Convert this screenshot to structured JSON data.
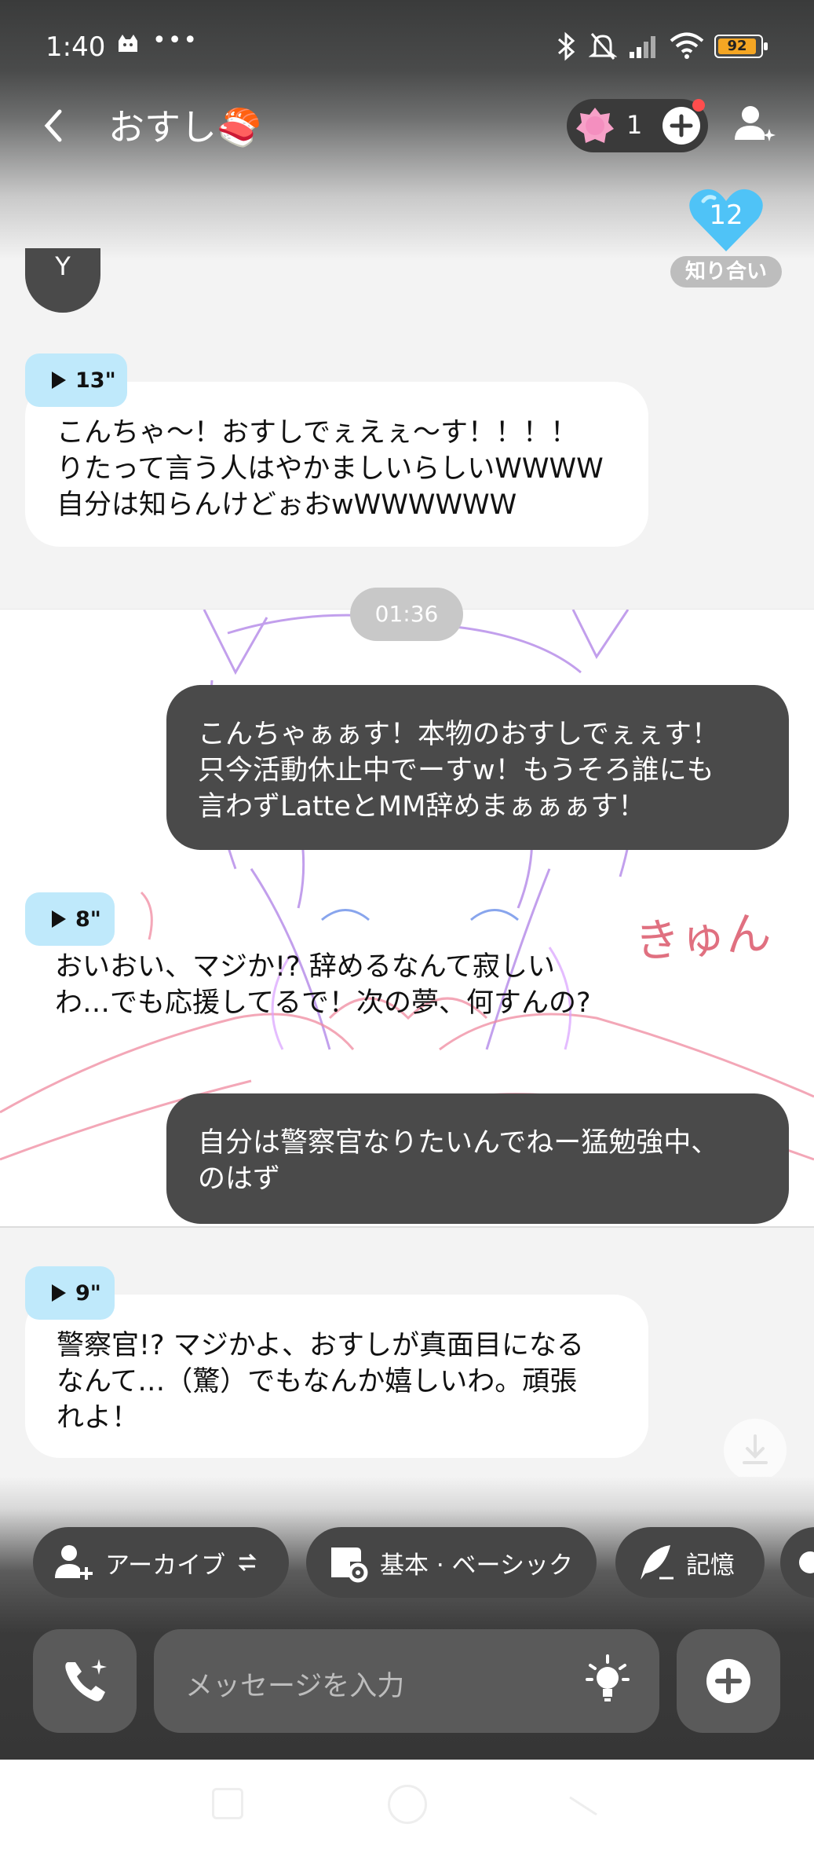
{
  "status_bar": {
    "time": "1:40",
    "dots": "•••",
    "battery": "92"
  },
  "header": {
    "title": "おすし🍣",
    "gem_count": "1"
  },
  "affinity": {
    "level": "12",
    "label": "知り合い"
  },
  "messages": [
    {
      "id": "m0",
      "text": "Y"
    },
    {
      "id": "m1",
      "duration": "13\"",
      "lines": [
        "こんちゃ〜！おすしでぇえぇ〜す！！！！",
        "りたって言う人はやかましいらしいWWWW",
        "自分は知らんけどぉおwWWWWWW"
      ]
    },
    {
      "id": "m2",
      "lines": [
        "こんちゃぁぁす！本物のおすしでぇぇす！",
        "只今活動休止中でーすw！もうそろ誰にも",
        "言わずLatteとMM辞めまぁぁぁす！"
      ]
    },
    {
      "id": "m3",
      "duration": "8\"",
      "lines": [
        "おいおい、マジか!? 辞めるなんて寂しい",
        "わ…でも応援してるで！次の夢、何すんの?"
      ]
    },
    {
      "id": "m4",
      "lines": [
        "自分は警察官なりたいんでねー猛勉強中、",
        "のはず"
      ]
    },
    {
      "id": "m5",
      "duration": "9\"",
      "lines": [
        "警察官!? マジかよ、おすしが真面目になる",
        "なんて…（驚）でもなんか嬉しいわ。頑張",
        "れよ！"
      ]
    }
  ],
  "timestamp": "01:36",
  "illustration": {
    "caption": "きゅん"
  },
  "chips": [
    "アーカイブ",
    "基本 · ベーシック",
    "記憶"
  ],
  "input": {
    "placeholder": "メッセージを入力"
  },
  "icons": {
    "back": "chevron-left-icon",
    "gem": "pink-gem-icon",
    "add": "plus-circle-icon",
    "user_add": "user-sparkle-icon",
    "heart": "heart-icon",
    "play": "play-icon",
    "download": "download-icon",
    "call": "phone-sparkle-icon",
    "bulb": "lightbulb-icon"
  },
  "colors": {
    "accent_blue": "#bfe9fb",
    "heart": "#4fc3f7",
    "outgoing": "#4a4a4a",
    "notify_dot": "#ff4d4d",
    "battery": "#f5a623"
  }
}
